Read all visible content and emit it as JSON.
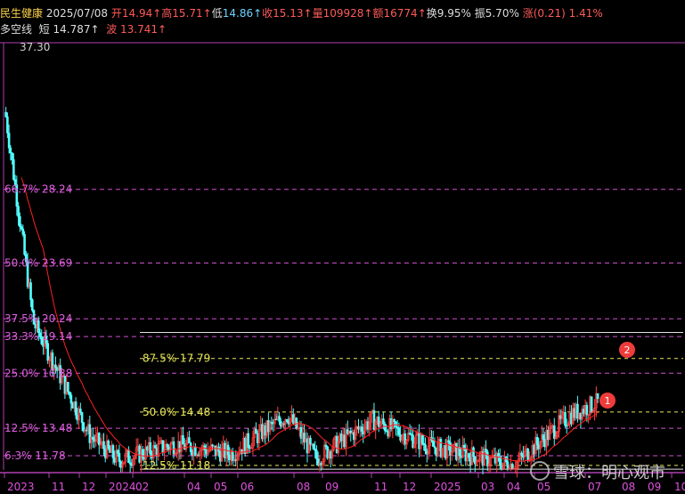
{
  "header": {
    "stock_name": "民生健康",
    "date": "2025/07/08",
    "open_label": "开",
    "open_value": "14.94",
    "high_label": "高",
    "high_value": "15.71",
    "low_label": "低",
    "low_value": "14.86",
    "close_label": "收",
    "close_value": "15.13",
    "volume_label": "量",
    "volume_value": "109928",
    "amount_label": "额",
    "amount_value": "16774",
    "turnover_label": "换",
    "turnover_value": "9.95%",
    "amplitude_label": "振",
    "amplitude_value": "5.70%",
    "change_label": "涨",
    "change_value": "(0.21)",
    "change_pct": "1.41%",
    "arrow": "↑"
  },
  "indicator": {
    "name": "多空线",
    "short_label": "短",
    "short_value": "14.787",
    "wave_label": "波",
    "wave_value": "13.741"
  },
  "price_top_label": "37.30",
  "levels": [
    {
      "label": "66.7% 28.24",
      "price": 28.24
    },
    {
      "label": "50.0% 23.69",
      "price": 23.69
    },
    {
      "label": "37.5% 20.24",
      "price": 20.24
    },
    {
      "label": "33.3% 19.14",
      "price": 19.14
    },
    {
      "label": "25.0% 16.88",
      "price": 16.88
    },
    {
      "label": "12.5% 13.48",
      "price": 13.48
    },
    {
      "label": "6.3% 11.78",
      "price": 11.78
    }
  ],
  "sub_levels": [
    {
      "label": "87.5% 17.79",
      "price": 17.79
    },
    {
      "label": "50.0% 14.48",
      "price": 14.48
    },
    {
      "label": "12.5% 11.18",
      "price": 11.18
    }
  ],
  "markers": [
    {
      "text": "2"
    },
    {
      "text": "1"
    }
  ],
  "x_axis": [
    "2023",
    "11",
    "12",
    "2024",
    "02",
    "04",
    "05",
    "06",
    "08",
    "09",
    "11",
    "12",
    "2025",
    "03",
    "04",
    "05",
    "07",
    "08",
    "09",
    "10"
  ],
  "watermark": "雪球：明心观市",
  "colors": {
    "up": "#ff4040",
    "down": "#54ffff",
    "level_line": "#d050d0",
    "sub_level_line": "#e8e85a",
    "ma_line": "#ff2020"
  },
  "chart_data": {
    "type": "candlestick",
    "title": "",
    "ylim": [
      10.9,
      37.3
    ],
    "approx_close_path": [
      {
        "x": "2023-10",
        "y": 33.0
      },
      {
        "x": "2023-11",
        "y": 20.0
      },
      {
        "x": "2023-12",
        "y": 16.5
      },
      {
        "x": "2024-01",
        "y": 13.0
      },
      {
        "x": "2024-02",
        "y": 11.5
      },
      {
        "x": "2024-04",
        "y": 12.5
      },
      {
        "x": "2024-06",
        "y": 11.9
      },
      {
        "x": "2024-08",
        "y": 14.3
      },
      {
        "x": "2024-09",
        "y": 11.6
      },
      {
        "x": "2024-11",
        "y": 14.0
      },
      {
        "x": "2025-01",
        "y": 12.4
      },
      {
        "x": "2025-04",
        "y": 11.2
      },
      {
        "x": "2025-06",
        "y": 14.3
      },
      {
        "x": "2025-07",
        "y": 15.1
      }
    ]
  }
}
